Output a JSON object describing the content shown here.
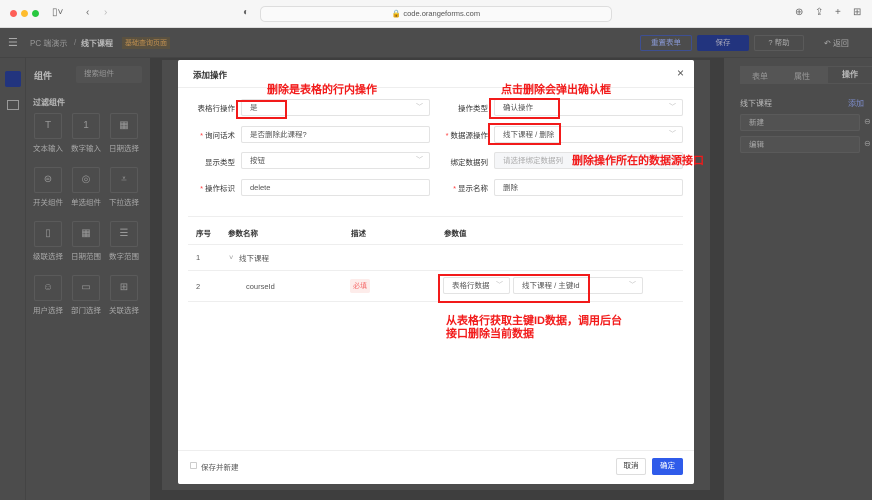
{
  "browser": {
    "url": "code.orangeforms.com"
  },
  "app": {
    "breadcrumb_root": "PC 端演示",
    "breadcrumb_sep": "/",
    "breadcrumb_current": "线下课程",
    "page_tag": "基础查询页面",
    "reset_label": "重置表单",
    "save_label": "保存",
    "help_label": "帮助",
    "back_label": "返回"
  },
  "left_panel": {
    "title": "组件",
    "search_placeholder": "搜索组件",
    "section": "过滤组件",
    "items": [
      {
        "label": "文本输入",
        "icon": "T"
      },
      {
        "label": "数字输入",
        "icon": "1"
      },
      {
        "label": "日期选择",
        "icon": "▦"
      },
      {
        "label": "开关组件",
        "icon": "⊜"
      },
      {
        "label": "单选组件",
        "icon": "◎"
      },
      {
        "label": "下拉选择",
        "icon": "⩡"
      },
      {
        "label": "级联选择",
        "icon": "▯"
      },
      {
        "label": "日期范围",
        "icon": "▦"
      },
      {
        "label": "数字范围",
        "icon": "☰"
      },
      {
        "label": "用户选择",
        "icon": "☺"
      },
      {
        "label": "部门选择",
        "icon": "▭"
      },
      {
        "label": "关联选择",
        "icon": "⊞"
      }
    ]
  },
  "right_panel": {
    "tabs": [
      "表单",
      "属性",
      "操作"
    ],
    "section": "线下课程",
    "add_label": "添加",
    "items": [
      "新建",
      "编辑"
    ]
  },
  "modal": {
    "title": "添加操作",
    "close": "×",
    "fields": {
      "row_op": {
        "label": "表格行操作",
        "value": "是"
      },
      "op_type": {
        "label": "操作类型",
        "value": "确认操作"
      },
      "ask": {
        "label": "询问话术",
        "value": "是否删除此课程?"
      },
      "ds_op": {
        "label": "数据源操作",
        "value": "线下课程 / 删除"
      },
      "display_type": {
        "label": "显示类型",
        "value": "按钮"
      },
      "bind_col": {
        "label": "绑定数据列",
        "placeholder": "请选择绑定数据列"
      },
      "op_id": {
        "label": "操作标识",
        "value": "delete"
      },
      "display_name": {
        "label": "显示名称",
        "value": "删除"
      }
    },
    "table": {
      "headers": [
        "序号",
        "参数名称",
        "描述",
        "参数值"
      ],
      "rows": [
        {
          "no": "1",
          "name": "线下课程"
        },
        {
          "no": "2",
          "name": "courseId",
          "desc": "必填",
          "source": "表格行数据",
          "value": "线下课程 / 主键Id"
        }
      ]
    },
    "save_new": "保存并新建",
    "cancel": "取消",
    "ok": "确定"
  },
  "annotations": {
    "a1": "删除是表格的行内操作",
    "a2": "点击删除会弹出确认框",
    "a3": "删除操作所在的数据源接口",
    "a4_line1": "从表格行获取主键ID数据，调用后台",
    "a4_line2": "接口删除当前数据"
  }
}
